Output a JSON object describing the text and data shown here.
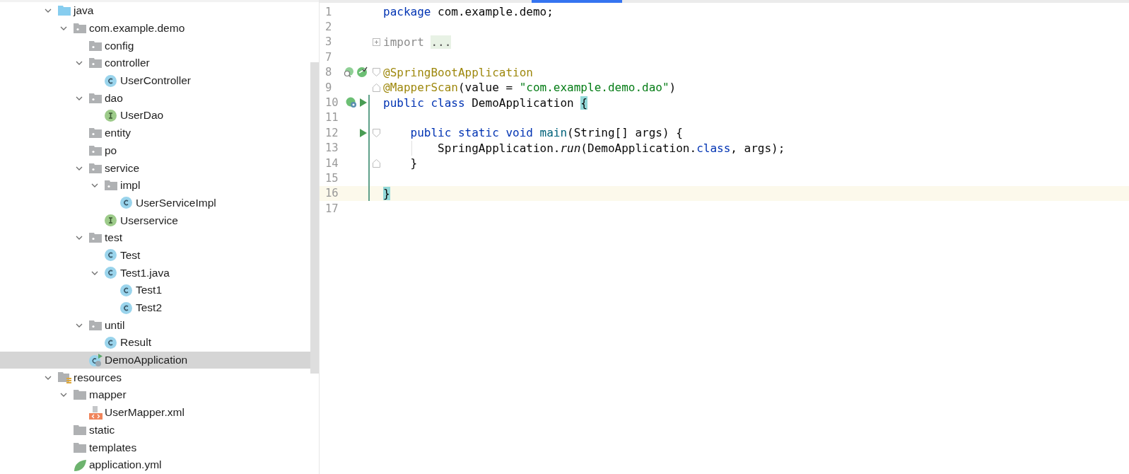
{
  "project_tree": [
    {
      "label": "java",
      "kind": "source-root",
      "expanded": true,
      "selected": false,
      "children": [
        {
          "label": "com.example.demo",
          "kind": "package",
          "expanded": true,
          "selected": false,
          "children": [
            {
              "label": "config",
              "kind": "package",
              "selected": false
            },
            {
              "label": "controller",
              "kind": "package",
              "expanded": true,
              "selected": false,
              "children": [
                {
                  "label": "UserController",
                  "kind": "class",
                  "selected": false
                }
              ]
            },
            {
              "label": "dao",
              "kind": "package",
              "expanded": true,
              "selected": false,
              "children": [
                {
                  "label": "UserDao",
                  "kind": "interface",
                  "selected": false
                }
              ]
            },
            {
              "label": "entity",
              "kind": "package",
              "selected": false
            },
            {
              "label": "po",
              "kind": "package",
              "selected": false
            },
            {
              "label": "service",
              "kind": "package",
              "expanded": true,
              "selected": false,
              "children": [
                {
                  "label": "impl",
                  "kind": "package",
                  "expanded": true,
                  "selected": false,
                  "children": [
                    {
                      "label": "UserServiceImpl",
                      "kind": "class",
                      "selected": false
                    }
                  ]
                },
                {
                  "label": "Userservice",
                  "kind": "interface",
                  "selected": false
                }
              ]
            },
            {
              "label": "test",
              "kind": "package",
              "expanded": true,
              "selected": false,
              "children": [
                {
                  "label": "Test",
                  "kind": "class",
                  "selected": false
                },
                {
                  "label": "Test1.java",
                  "kind": "class",
                  "expanded": true,
                  "selected": false,
                  "children": [
                    {
                      "label": "Test1",
                      "kind": "class",
                      "selected": false
                    },
                    {
                      "label": "Test2",
                      "kind": "class",
                      "selected": false
                    }
                  ]
                }
              ]
            },
            {
              "label": "until",
              "kind": "package",
              "expanded": true,
              "selected": false,
              "children": [
                {
                  "label": "Result",
                  "kind": "class",
                  "selected": false
                }
              ]
            },
            {
              "label": "DemoApplication",
              "kind": "spring-app",
              "selected": true
            }
          ]
        }
      ]
    },
    {
      "label": "resources",
      "kind": "resources-root",
      "expanded": true,
      "selected": false,
      "children": [
        {
          "label": "mapper",
          "kind": "folder",
          "expanded": true,
          "selected": false,
          "children": [
            {
              "label": "UserMapper.xml",
              "kind": "xml",
              "selected": false
            }
          ]
        },
        {
          "label": "static",
          "kind": "folder",
          "selected": false
        },
        {
          "label": "templates",
          "kind": "folder",
          "selected": false
        },
        {
          "label": "application.yml",
          "kind": "yml",
          "selected": false
        }
      ]
    }
  ],
  "editor": {
    "lines": [
      {
        "number": "1",
        "current": false,
        "changed": false,
        "tokens": [
          {
            "kind": "keyword",
            "text": "package"
          },
          {
            "kind": "plain",
            "text": " com.example.demo;"
          }
        ]
      },
      {
        "number": "2",
        "current": false,
        "changed": false
      },
      {
        "number": "3",
        "current": false,
        "changed": false,
        "fold": {
          "kind": "collapsed"
        },
        "tokens": [
          {
            "kind": "dim",
            "text": "import "
          },
          {
            "kind": "folded",
            "text": "..."
          }
        ]
      },
      {
        "number": "7",
        "current": false,
        "changed": false
      },
      {
        "number": "8",
        "current": false,
        "changed": false,
        "fold": {
          "kind": "start"
        },
        "gutter": [
          {
            "kind": "bean"
          },
          {
            "kind": "bean-check"
          }
        ],
        "tokens": [
          {
            "kind": "annotation",
            "text": "@SpringBootApplication"
          }
        ]
      },
      {
        "number": "9",
        "current": false,
        "changed": false,
        "fold": {
          "kind": "end"
        },
        "tokens": [
          {
            "kind": "annotation",
            "text": "@MapperScan"
          },
          {
            "kind": "plain",
            "text": "(value = "
          },
          {
            "kind": "string",
            "text": "\"com.example.demo.dao\""
          },
          {
            "kind": "plain",
            "text": ")"
          }
        ]
      },
      {
        "number": "10",
        "current": false,
        "changed": true,
        "gutter": [
          {
            "kind": "spring-run"
          },
          {
            "kind": "run"
          }
        ],
        "tokens": [
          {
            "kind": "keyword",
            "text": "public class"
          },
          {
            "kind": "plain",
            "text": " DemoApplication "
          },
          {
            "kind": "match",
            "text": "{"
          }
        ]
      },
      {
        "number": "11",
        "current": false,
        "changed": true
      },
      {
        "number": "12",
        "current": false,
        "changed": true,
        "fold": {
          "kind": "start"
        },
        "gutter": [
          {
            "kind": "run"
          }
        ],
        "tokens": [
          {
            "kind": "keyword",
            "text": "    public static void "
          },
          {
            "kind": "method",
            "text": "main"
          },
          {
            "kind": "plain",
            "text": "(String[] args) {"
          }
        ]
      },
      {
        "number": "13",
        "current": false,
        "changed": true,
        "guide": true,
        "tokens": [
          {
            "kind": "plain",
            "text": "        SpringApplication."
          },
          {
            "kind": "italic",
            "text": "run"
          },
          {
            "kind": "plain",
            "text": "(DemoApplication."
          },
          {
            "kind": "keyword",
            "text": "class"
          },
          {
            "kind": "plain",
            "text": ", args);"
          }
        ]
      },
      {
        "number": "14",
        "current": false,
        "changed": true,
        "fold": {
          "kind": "end"
        },
        "tokens": [
          {
            "kind": "plain",
            "text": "    }"
          }
        ]
      },
      {
        "number": "15",
        "current": false,
        "changed": true
      },
      {
        "number": "16",
        "current": true,
        "changed": true,
        "tokens": [
          {
            "kind": "match",
            "text": "}"
          }
        ]
      },
      {
        "number": "17",
        "current": false,
        "changed": false
      }
    ]
  }
}
